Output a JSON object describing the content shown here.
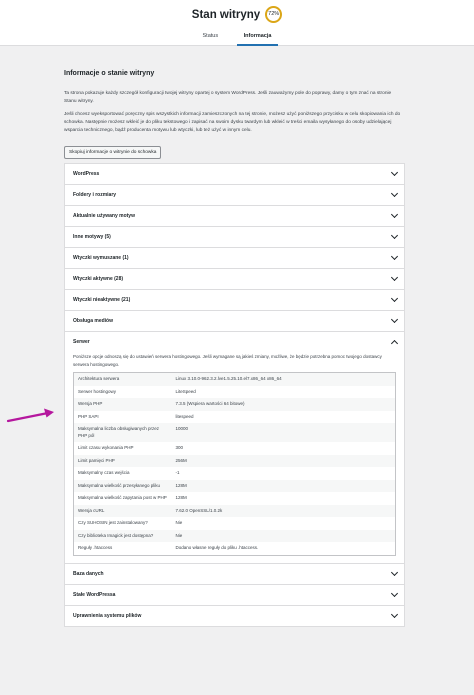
{
  "header": {
    "title": "Stan witryny",
    "score": "72%",
    "tabs": [
      {
        "label": "Status",
        "active": false
      },
      {
        "label": "Informacja",
        "active": true
      }
    ]
  },
  "info": {
    "title": "Informacje o stanie witryny",
    "paragraph1": "Ta strona pokazuje każdy szczegół konfiguracji twojej witryny opartej o system WordPress. Jeśli zauważymy pole do poprawy, damy o tym znać na stronie Stanu witryny.",
    "paragraph2": "Jeśli chcesz wyeksportować poręczny spis wszystkich informacji zamieszczonych na tej stronie, możesz użyć poniższego przycisku w celu skopiowania ich do schowka. Następnie możesz wkleić je do pliku tekstowego i zapisać na swoim dysku twardym lub wkleić w treści emaila wysyłanego do osoby udzielającej wsparcia technicznego, bądź producenta motywu lub wtyczki, lub też użyć w innym celu.",
    "copy_button": "Skopiuj informacje o witrynie do schowka"
  },
  "sections_before": [
    "WordPress",
    "Foldery i rozmiary",
    "Aktualnie używany motyw",
    "Inne motywy (5)",
    "Wtyczki wymuszane (1)",
    "Wtyczki aktywne (28)",
    "Wtyczki nieaktywne (21)",
    "Obsługa mediów"
  ],
  "server": {
    "title": "Serwer",
    "description": "Poniższe opcje odnoszą się do ustawień serwera hostingowego. Jeśli wymagane są jakieś zmiany, możliwe, że będzie potrzebna pomoc twojego dostawcy serwera hostingowego.",
    "rows": [
      {
        "key": "Architektura serwera",
        "value": "Linux 3.10.0-962.3.2.lve1.5.25.10.el7.x86_64 x86_64"
      },
      {
        "key": "Serwer hostingowy",
        "value": "LiteSpeed"
      },
      {
        "key": "Wersja PHP",
        "value": "7.3.5 (Wspiera wartości 64 bitowe)"
      },
      {
        "key": "PHP SAPI",
        "value": "litespeed"
      },
      {
        "key": "Maksymalna liczba obsługiwanych przez PHP pól",
        "value": "10000"
      },
      {
        "key": "Limit czasu wykonania PHP",
        "value": "300"
      },
      {
        "key": "Limit pamięci PHP",
        "value": "256M"
      },
      {
        "key": "Maksymalny czas wejścia",
        "value": "-1"
      },
      {
        "key": "Maksymalna wielkość przesyłanego pliku",
        "value": "128M"
      },
      {
        "key": "Maksymalna wielkość zapytania post w PHP",
        "value": "128M"
      },
      {
        "key": "Wersja cURL",
        "value": "7.62.0 OpenSSL/1.0.2k"
      },
      {
        "key": "Czy SUHOSIN jest zainstalowany?",
        "value": "Nie"
      },
      {
        "key": "Czy biblioteka Imagick jest dostępna?",
        "value": "Nie"
      },
      {
        "key": "Reguły .htaccess",
        "value": "Dodano własne reguły do pliku .htaccess."
      }
    ]
  },
  "sections_after": [
    "Baza danych",
    "Stałe WordPressa",
    "Uprawnienia systemu plików"
  ],
  "colors": {
    "score_ring": "#dba617",
    "active_tab": "#2271b1",
    "annotation_arrow": "#b5179e"
  }
}
